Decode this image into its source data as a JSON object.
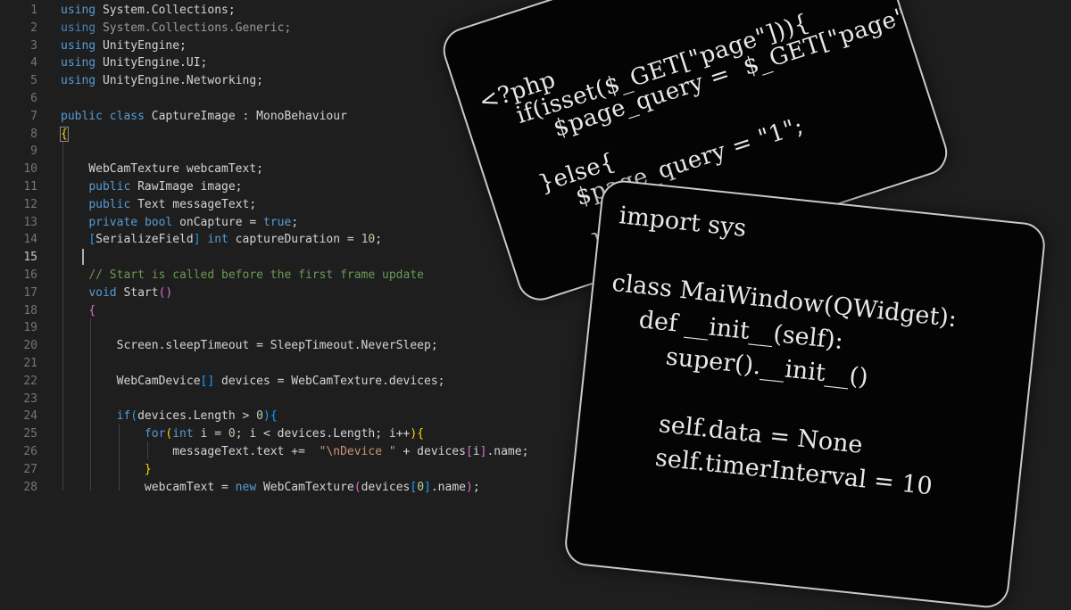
{
  "editor": {
    "lines": [
      {
        "n": "1",
        "toks": [
          [
            "kw",
            "using"
          ],
          [
            "t",
            " System.Collections;"
          ]
        ]
      },
      {
        "n": "2",
        "toks": [
          [
            "kwdim",
            "using"
          ],
          [
            "ns",
            " System.Collections.Generic;"
          ]
        ]
      },
      {
        "n": "3",
        "toks": [
          [
            "kw",
            "using"
          ],
          [
            "t",
            " UnityEngine;"
          ]
        ]
      },
      {
        "n": "4",
        "toks": [
          [
            "kw",
            "using"
          ],
          [
            "t",
            " UnityEngine.UI;"
          ]
        ]
      },
      {
        "n": "5",
        "toks": [
          [
            "kw",
            "using"
          ],
          [
            "t",
            " UnityEngine.Networking;"
          ]
        ]
      },
      {
        "n": "6",
        "toks": []
      },
      {
        "n": "7",
        "toks": [
          [
            "kw",
            "public"
          ],
          [
            "t",
            " "
          ],
          [
            "kw",
            "class"
          ],
          [
            "t",
            " CaptureImage : MonoBehaviour"
          ]
        ]
      },
      {
        "n": "8",
        "toks": [
          [
            "br1",
            "{"
          ]
        ]
      },
      {
        "n": "9",
        "toks": []
      },
      {
        "n": "10",
        "toks": [
          [
            "t",
            "    WebCamTexture webcamText;"
          ]
        ]
      },
      {
        "n": "11",
        "toks": [
          [
            "t",
            "    "
          ],
          [
            "kw",
            "public"
          ],
          [
            "t",
            " RawImage image;"
          ]
        ]
      },
      {
        "n": "12",
        "toks": [
          [
            "t",
            "    "
          ],
          [
            "kw",
            "public"
          ],
          [
            "t",
            " Text messageText;"
          ]
        ]
      },
      {
        "n": "13",
        "toks": [
          [
            "t",
            "    "
          ],
          [
            "kw",
            "private"
          ],
          [
            "t",
            " "
          ],
          [
            "kw",
            "bool"
          ],
          [
            "t",
            " onCapture = "
          ],
          [
            "kw",
            "true"
          ],
          [
            "t",
            ";"
          ]
        ]
      },
      {
        "n": "14",
        "toks": [
          [
            "t",
            "    "
          ],
          [
            "br3",
            "["
          ],
          [
            "t",
            "SerializeField"
          ],
          [
            "br3",
            "]"
          ],
          [
            "t",
            " "
          ],
          [
            "kw",
            "int"
          ],
          [
            "t",
            " captureDuration = "
          ],
          [
            "num",
            "10"
          ],
          [
            "t",
            ";"
          ]
        ]
      },
      {
        "n": "15",
        "toks": [],
        "current": true
      },
      {
        "n": "16",
        "toks": [
          [
            "t",
            "    "
          ],
          [
            "cmt",
            "// Start is called before the first frame update"
          ]
        ]
      },
      {
        "n": "17",
        "toks": [
          [
            "t",
            "    "
          ],
          [
            "kw",
            "void"
          ],
          [
            "t",
            " Start"
          ],
          [
            "br2",
            "()"
          ]
        ]
      },
      {
        "n": "18",
        "toks": [
          [
            "t",
            "    "
          ],
          [
            "br2",
            "{"
          ]
        ]
      },
      {
        "n": "19",
        "toks": []
      },
      {
        "n": "20",
        "toks": [
          [
            "t",
            "        Screen.sleepTimeout = SleepTimeout.NeverSleep;"
          ]
        ]
      },
      {
        "n": "21",
        "toks": []
      },
      {
        "n": "22",
        "toks": [
          [
            "t",
            "        WebCamDevice"
          ],
          [
            "br3",
            "[]"
          ],
          [
            "t",
            " devices = WebCamTexture.devices;"
          ]
        ]
      },
      {
        "n": "23",
        "toks": []
      },
      {
        "n": "24",
        "toks": [
          [
            "t",
            "        "
          ],
          [
            "kw",
            "if"
          ],
          [
            "br3",
            "("
          ],
          [
            "t",
            "devices.Length > "
          ],
          [
            "num",
            "0"
          ],
          [
            "br3",
            ")"
          ],
          [
            "br3",
            "{"
          ]
        ]
      },
      {
        "n": "25",
        "toks": [
          [
            "t",
            "            "
          ],
          [
            "kw",
            "for"
          ],
          [
            "br1",
            "("
          ],
          [
            "kw",
            "int"
          ],
          [
            "t",
            " i = "
          ],
          [
            "num",
            "0"
          ],
          [
            "t",
            "; i < devices.Length; i++"
          ],
          [
            "br1",
            ")"
          ],
          [
            "br1",
            "{"
          ]
        ]
      },
      {
        "n": "26",
        "toks": [
          [
            "t",
            "                messageText.text +=  "
          ],
          [
            "str",
            "\"\\nDevice \""
          ],
          [
            "t",
            " + devices"
          ],
          [
            "br2",
            "["
          ],
          [
            "t",
            "i"
          ],
          [
            "br2",
            "]"
          ],
          [
            "t",
            ".name;"
          ]
        ]
      },
      {
        "n": "27",
        "toks": [
          [
            "t",
            "            "
          ],
          [
            "br1",
            "}"
          ]
        ]
      },
      {
        "n": "28",
        "toks": [
          [
            "t",
            "            webcamText = "
          ],
          [
            "kw",
            "new"
          ],
          [
            "t",
            " WebCamTexture"
          ],
          [
            "br2",
            "("
          ],
          [
            "t",
            "devices"
          ],
          [
            "br3",
            "["
          ],
          [
            "num",
            "0"
          ],
          [
            "br3",
            "]"
          ],
          [
            "t",
            ".name"
          ],
          [
            "br2",
            ")"
          ],
          [
            "t",
            ";"
          ]
        ]
      }
    ]
  },
  "php_card": {
    "lines": [
      "<?php",
      "    if(isset($_GET[\"page\"])){",
      "        $page_query =  $_GET[\"page\"];",
      "",
      "    }else{",
      "        $page_query = \"1\";",
      "",
      "        }",
      "",
      "?>"
    ]
  },
  "python_card": {
    "lines": [
      "import sys",
      "",
      "class MaiWindow(QWidget):",
      "    def __init__(self):",
      "        super().__init__()",
      "",
      "        self.data = None",
      "        self.timerInterval = 10"
    ]
  },
  "colors": {
    "background": "#1e1e1e",
    "keyword": "#569cd6",
    "comment": "#6a9955",
    "string": "#ce9178",
    "number": "#b5cea8",
    "card_bg": "#040404",
    "card_border": "#c9c9c9"
  }
}
